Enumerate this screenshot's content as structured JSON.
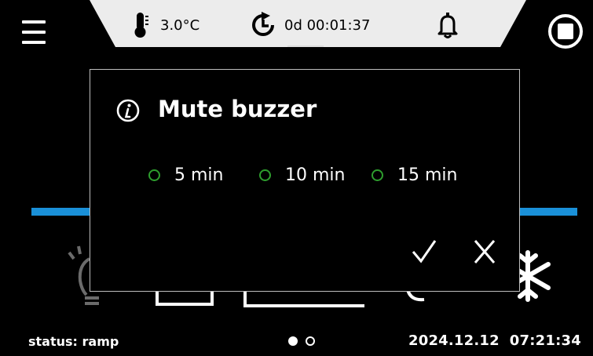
{
  "header": {
    "temperature": "3.0°C",
    "timer": "0d 00:01:37"
  },
  "dialog": {
    "title": "Mute buzzer",
    "options": [
      {
        "label": "5 min"
      },
      {
        "label": "10 min"
      },
      {
        "label": "15 min"
      }
    ]
  },
  "footer": {
    "status": "status: ramp",
    "datetime": "2024.12.12  07:21:34"
  },
  "colors": {
    "accent_blue": "#1a90d8",
    "radio_green": "#2e9e2e",
    "header_bg": "#ececec"
  },
  "icons": [
    "menu-icon",
    "thermometer-icon",
    "timer-icon",
    "bell-icon",
    "stop-icon",
    "info-icon",
    "check-icon",
    "close-icon",
    "lightbulb-icon",
    "snowflake-icon"
  ]
}
